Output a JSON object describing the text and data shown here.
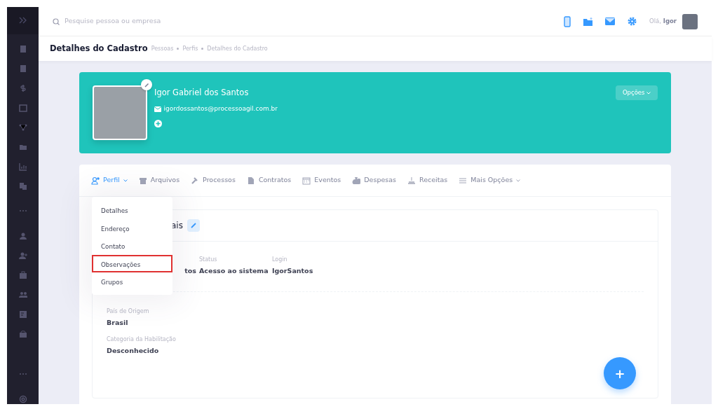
{
  "search": {
    "placeholder": "Pesquise pessoa ou empresa"
  },
  "user": {
    "greeting": "Olá,",
    "name": "Igor"
  },
  "header": {
    "title": "Detalhes do Cadastro",
    "breadcrumb": [
      "Pessoas",
      "Perfis",
      "Detalhes do Cadastro"
    ]
  },
  "profile": {
    "name": "Igor Gabriel dos Santos",
    "email": "igordossantos@processoagil.com.br",
    "options_button": "Opções"
  },
  "tabs": [
    {
      "label": "Perfil",
      "selected": true,
      "dropdown": true
    },
    {
      "label": "Arquivos",
      "selected": false,
      "dropdown": false
    },
    {
      "label": "Processos",
      "selected": false,
      "dropdown": false
    },
    {
      "label": "Contratos",
      "selected": false,
      "dropdown": false
    },
    {
      "label": "Eventos",
      "selected": false,
      "dropdown": false
    },
    {
      "label": "Despesas",
      "selected": false,
      "dropdown": false
    },
    {
      "label": "Receitas",
      "selected": false,
      "dropdown": false
    },
    {
      "label": "Mais Opções",
      "selected": false,
      "dropdown": true
    }
  ],
  "profile_menu": [
    {
      "label": "Detalhes",
      "highlighted": false
    },
    {
      "label": "Endereço",
      "highlighted": false
    },
    {
      "label": "Contato",
      "highlighted": false
    },
    {
      "label": "Observações",
      "highlighted": true
    },
    {
      "label": "Grupos",
      "highlighted": false
    }
  ],
  "section": {
    "title": "ais",
    "fields_row": [
      {
        "value": "tos"
      },
      {
        "label": "Status",
        "value": "Acesso ao sistema"
      },
      {
        "label": "Login",
        "value": "IgorSantos"
      }
    ],
    "fields": [
      {
        "label": "País de Origem",
        "value": "Brasil"
      },
      {
        "label": "Categoria da Habilitação",
        "value": "Desconhecido"
      }
    ]
  },
  "fab": {
    "symbol": "+"
  }
}
